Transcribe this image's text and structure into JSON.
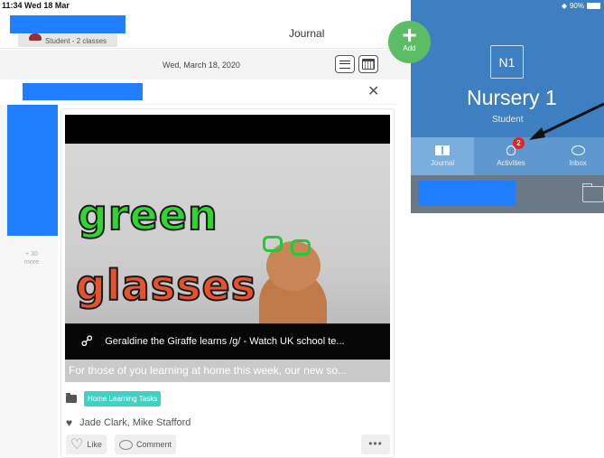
{
  "status_bar": {
    "time": "11:34  Wed 18 Mar",
    "battery": "90%"
  },
  "header": {
    "class_chip_text": "Student - 2 classes",
    "title": "Journal"
  },
  "add_button": {
    "label": "Add"
  },
  "date_bar": {
    "date": "Wed, March 18, 2020"
  },
  "filter": {
    "clear_symbol": "✕"
  },
  "side_strip": {
    "more_count": "+ 30",
    "more_label": "more"
  },
  "post": {
    "video_overlay_text": [
      "green",
      "glasses"
    ],
    "link_title": "Geraldine the Giraffe learns /g/ - Watch UK school te...",
    "caption": "For those of you learning at home this week, our new so...",
    "folder_tag": "Home Learning Tasks",
    "liked_by": "Jade Clark, Mike Stafford",
    "like_label": "Like",
    "comment_label": "Comment",
    "more_symbol": "•••"
  },
  "class_panel": {
    "initials": "N1",
    "name": "Nursery 1",
    "role": "Student",
    "tabs": [
      {
        "label": "Journal",
        "icon": "book-icon",
        "active": true
      },
      {
        "label": "Activities",
        "icon": "lightbulb-icon",
        "active": false,
        "badge": "2"
      },
      {
        "label": "Inbox",
        "icon": "chat-icon",
        "active": false
      }
    ]
  },
  "colors": {
    "panel_blue": "#3d7fc0",
    "tab_bar": "#5e98cf",
    "add_green": "#5cbd66",
    "tag_teal": "#3fd0c6",
    "badge_red": "#e02525",
    "redaction_blue": "#1f7fff"
  }
}
